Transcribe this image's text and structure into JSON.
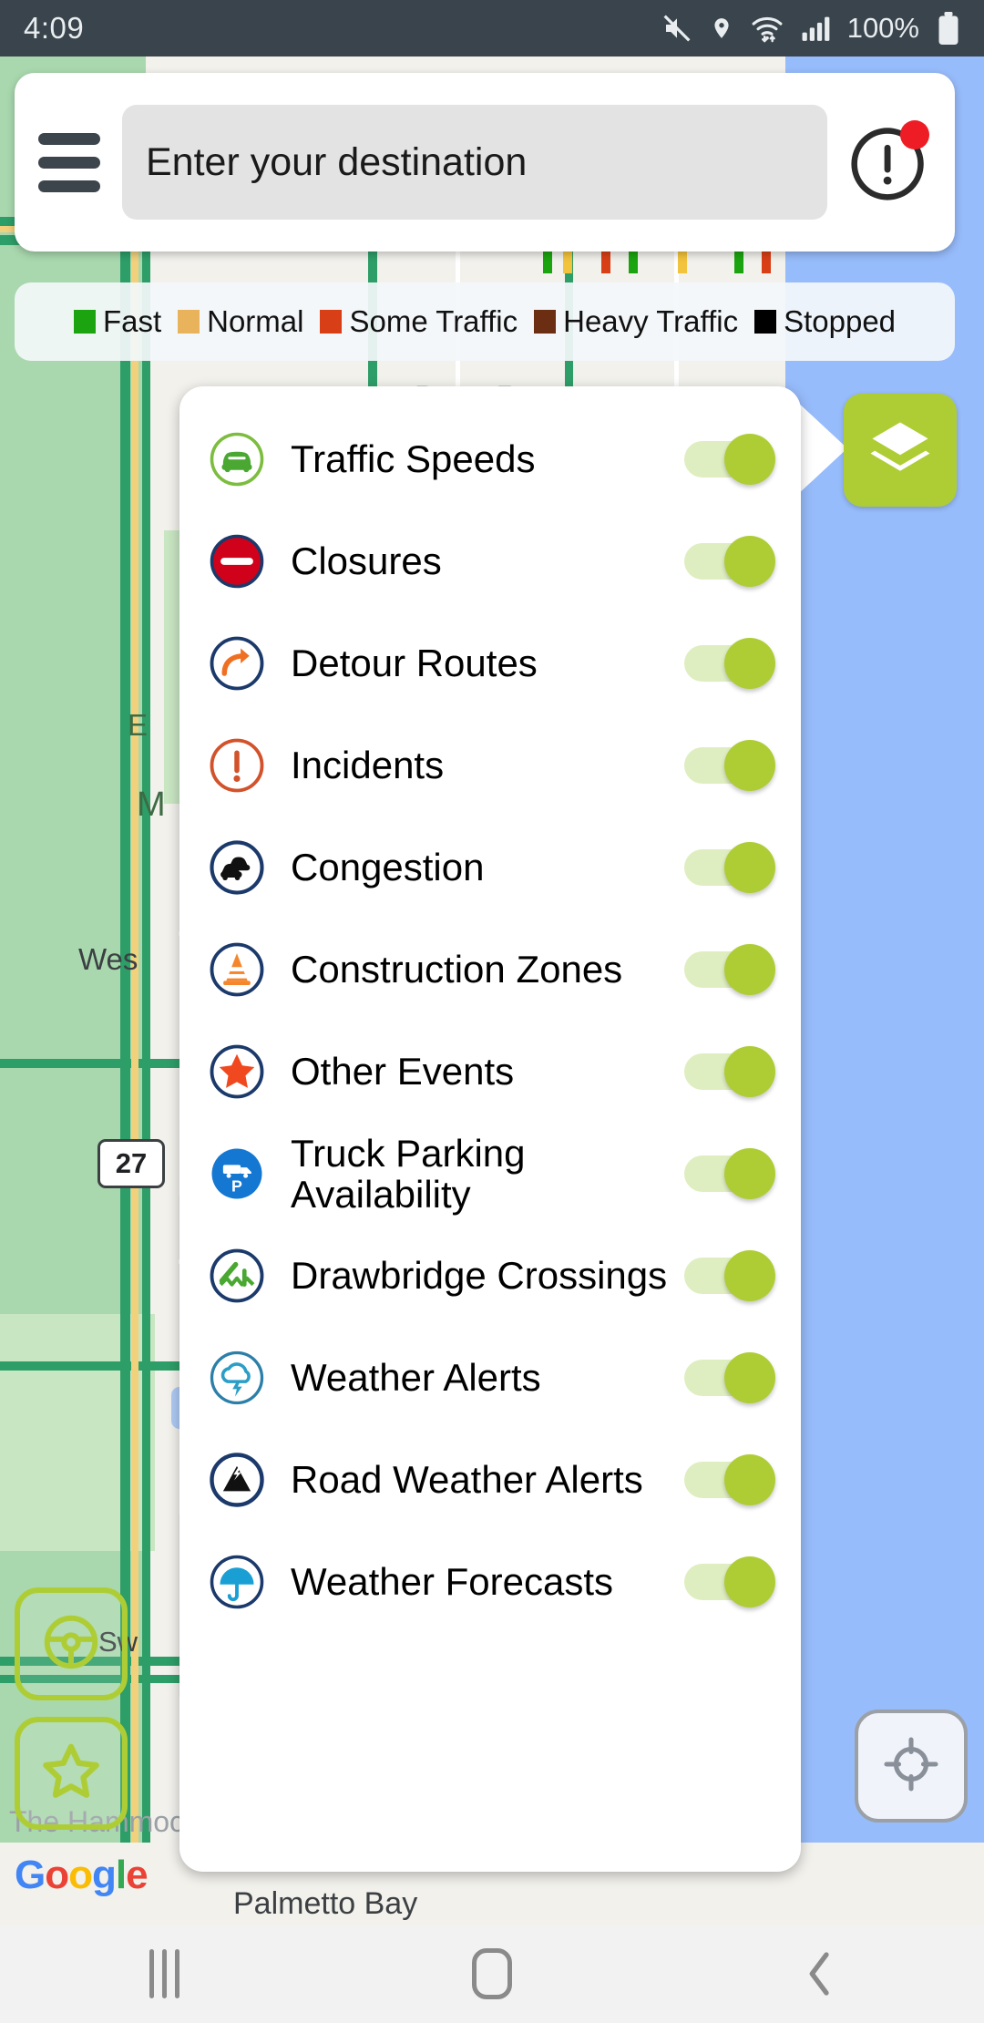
{
  "status_bar": {
    "time": "4:09",
    "battery_text": "100%",
    "icons": [
      "mute-icon",
      "location-pin-icon",
      "wifi-icon",
      "signal-bars-icon",
      "battery-icon"
    ]
  },
  "search": {
    "menu_icon": "hamburger-menu-icon",
    "placeholder": "Enter your destination",
    "value": "",
    "alert_icon": "alert-exclamation-icon",
    "alert_badge": true
  },
  "legend": {
    "items": [
      {
        "label": "Fast",
        "color": "#1ba40f"
      },
      {
        "label": "Normal",
        "color": "#e8b35a"
      },
      {
        "label": "Some Traffic",
        "color": "#d93f17"
      },
      {
        "label": "Heavy Traffic",
        "color": "#6b2e12"
      },
      {
        "label": "Stopped",
        "color": "#000000"
      }
    ]
  },
  "layers_button": {
    "icon": "layers-stack-icon",
    "color": "#aecd35"
  },
  "layers_panel": {
    "items": [
      {
        "label": "Traffic Speeds",
        "icon": "car-icon",
        "enabled": true
      },
      {
        "label": "Closures",
        "icon": "no-entry-icon",
        "enabled": true
      },
      {
        "label": "Detour Routes",
        "icon": "detour-arrow-icon",
        "enabled": true
      },
      {
        "label": "Incidents",
        "icon": "warning-icon",
        "enabled": true
      },
      {
        "label": "Congestion",
        "icon": "cars-queue-icon",
        "enabled": true
      },
      {
        "label": "Construction Zones",
        "icon": "traffic-cone-icon",
        "enabled": true
      },
      {
        "label": "Other Events",
        "icon": "star-icon",
        "enabled": true
      },
      {
        "label": "Truck Parking Availability",
        "icon": "truck-parking-icon",
        "enabled": true
      },
      {
        "label": "Drawbridge Crossings",
        "icon": "drawbridge-icon",
        "enabled": true
      },
      {
        "label": "Weather Alerts",
        "icon": "cloud-lightning-icon",
        "enabled": true
      },
      {
        "label": "Road Weather Alerts",
        "icon": "mountain-snow-icon",
        "enabled": true
      },
      {
        "label": "Weather Forecasts",
        "icon": "umbrella-icon",
        "enabled": true
      }
    ]
  },
  "map": {
    "labels": {
      "boca_raton": "Boca Raton",
      "west": "Wes",
      "m": "M",
      "e": "E",
      "sw": "Sw",
      "hammocks": "The Hammocks",
      "palmetto_bay": "Palmetto Bay",
      "route_shield": "27"
    },
    "attribution": "Google",
    "controls": [
      {
        "name": "drive-mode-button",
        "icon": "steering-wheel-icon"
      },
      {
        "name": "favorites-button",
        "icon": "star-outline-icon"
      },
      {
        "name": "locate-me-button",
        "icon": "crosshair-icon"
      }
    ]
  },
  "nav_bar": {
    "recents": "recents-icon",
    "home": "home-icon",
    "back": "back-icon"
  }
}
